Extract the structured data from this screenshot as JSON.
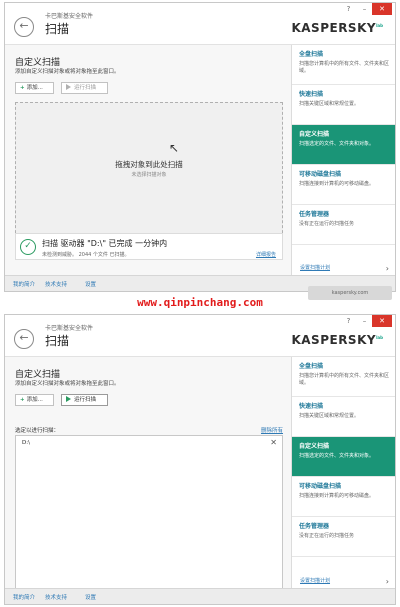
{
  "common": {
    "app_name": "卡巴斯基安全软件",
    "page_title": "扫描",
    "back_icon": "←",
    "window_controls": {
      "help": "?",
      "minimize": "–",
      "close": "✕"
    },
    "logo_text": "KASPERSKY",
    "logo_lab": "lab",
    "section_title": "自定义扫描",
    "section_subtitle": "添加自定义扫描对象或将对象拖至此窗口。",
    "add_button": "添加...",
    "run_button": "运行扫描",
    "sidebar": [
      {
        "title": "全盘扫描",
        "desc": "扫描您计算机中的所有文件、文件夹和区域。"
      },
      {
        "title": "快速扫描",
        "desc": "扫描关键区域和常规位置。"
      },
      {
        "title": "自定义扫描",
        "desc": "扫描选定的文件、文件夹和对象。"
      },
      {
        "title": "可移动磁盘扫描",
        "desc": "扫描连接到计算机的可移动磁盘。"
      },
      {
        "title": "任务管理器",
        "desc": "没有正在运行的扫描任务"
      }
    ],
    "sidebar_settings": "设置扫描计划",
    "footer": {
      "link1": "我的简介",
      "link2": "技术支持",
      "link3": "设置"
    },
    "colors": {
      "accent": "#1a9577",
      "close": "#d9352a",
      "link": "#2f7ab5",
      "watermark": "#e21b1b"
    }
  },
  "panel1": {
    "drop_main": "拖拽对象到此处扫描",
    "drop_sub": "未选择扫描对象",
    "status_main": "扫描 驱动器 \"D:\\\" 已完成  一分钟内",
    "status_sub": "未检测到威胁。 2044 个文件 已扫描。",
    "status_link": "详细报告"
  },
  "panel2": {
    "list_label": "选定以进行扫描：",
    "list_clear": "删除所有",
    "list_items": [
      "D:\\"
    ]
  },
  "watermark": "www.qinpinchang.com",
  "forum_badge": "kaspersky.com"
}
